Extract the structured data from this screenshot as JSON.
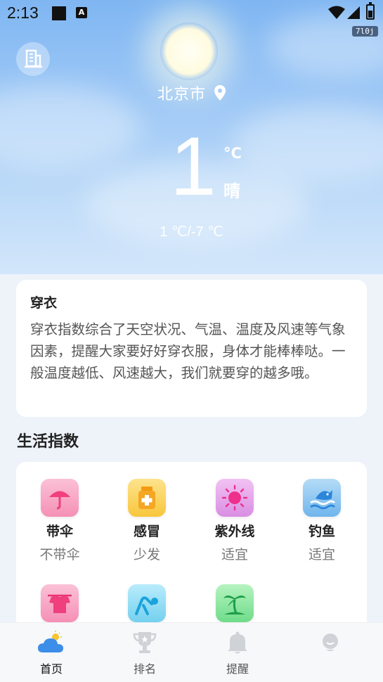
{
  "status_bar": {
    "time": "2:13",
    "notification_letter": "A",
    "badge": "7l0j"
  },
  "weather": {
    "city": "北京市",
    "current_temp": "1",
    "unit": "°C",
    "condition": "晴",
    "range": "1 ℃/-7 ℃"
  },
  "dressing": {
    "title": "穿衣",
    "description": "穿衣指数综合了天空状况、气温、温度及风速等气象因素，提醒大家要好好穿衣服，身体才能棒棒哒。一般温度越低、风速越大，我们就要穿的越多哦。"
  },
  "life_index": {
    "title": "生活指数",
    "items": [
      {
        "name": "带伞",
        "value": "不带伞",
        "icon": "umbrella-icon"
      },
      {
        "name": "感冒",
        "value": "少发",
        "icon": "medicine-icon"
      },
      {
        "name": "紫外线",
        "value": "适宜",
        "icon": "sun-icon"
      },
      {
        "name": "钓鱼",
        "value": "适宜",
        "icon": "fish-icon"
      },
      {
        "name": "",
        "value": "",
        "icon": "clothes-icon"
      },
      {
        "name": "",
        "value": "",
        "icon": "exercise-icon"
      },
      {
        "name": "",
        "value": "",
        "icon": "palm-tree-icon"
      }
    ]
  },
  "nav": {
    "items": [
      {
        "label": "首页",
        "icon": "weather-cloud-icon",
        "active": true
      },
      {
        "label": "排名",
        "icon": "trophy-icon",
        "active": false
      },
      {
        "label": "提醒",
        "icon": "bell-icon",
        "active": false
      },
      {
        "label": "",
        "icon": "profile-icon",
        "active": false
      }
    ]
  },
  "colors": {
    "sky_top": "#7fb6f2",
    "umbrella_tile": "#f7a6c4",
    "medicine_tile": "#fbd56a",
    "sun_tile": "#e6a7ec",
    "fish_tile": "#8dc8f2",
    "clothes_tile": "#f7a6c4",
    "exercise_tile": "#8fdcf3",
    "palm_tile": "#8ee6a0",
    "nav_active": "#3d8ee8"
  }
}
